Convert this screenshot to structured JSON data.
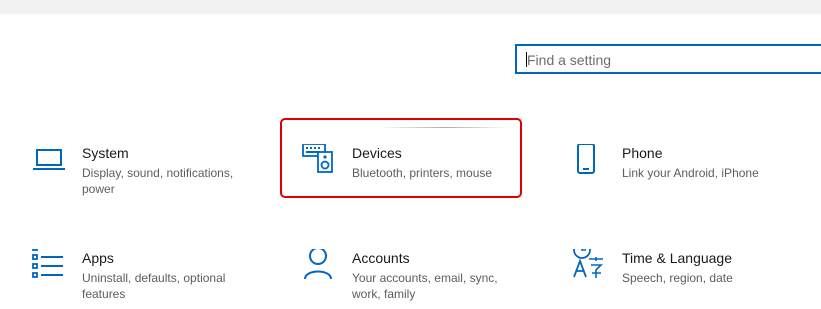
{
  "search": {
    "placeholder": "Find a setting",
    "value": ""
  },
  "colors": {
    "accent": "#0067c0",
    "highlight": "#e00000",
    "topbar": "#f2f2f2"
  },
  "tiles": [
    {
      "title": "System",
      "description": "Display, sound, notifications, power",
      "icon": "laptop-icon"
    },
    {
      "title": "Devices",
      "description": "Bluetooth, printers, mouse",
      "icon": "devices-icon"
    },
    {
      "title": "Phone",
      "description": "Link your Android, iPhone",
      "icon": "phone-icon"
    },
    {
      "title": "Apps",
      "description": "Uninstall, defaults, optional features",
      "icon": "apps-list-icon"
    },
    {
      "title": "Accounts",
      "description": "Your accounts, email, sync, work, family",
      "icon": "person-icon"
    },
    {
      "title": "Time & Language",
      "description": "Speech, region, date",
      "icon": "time-language-icon"
    }
  ]
}
